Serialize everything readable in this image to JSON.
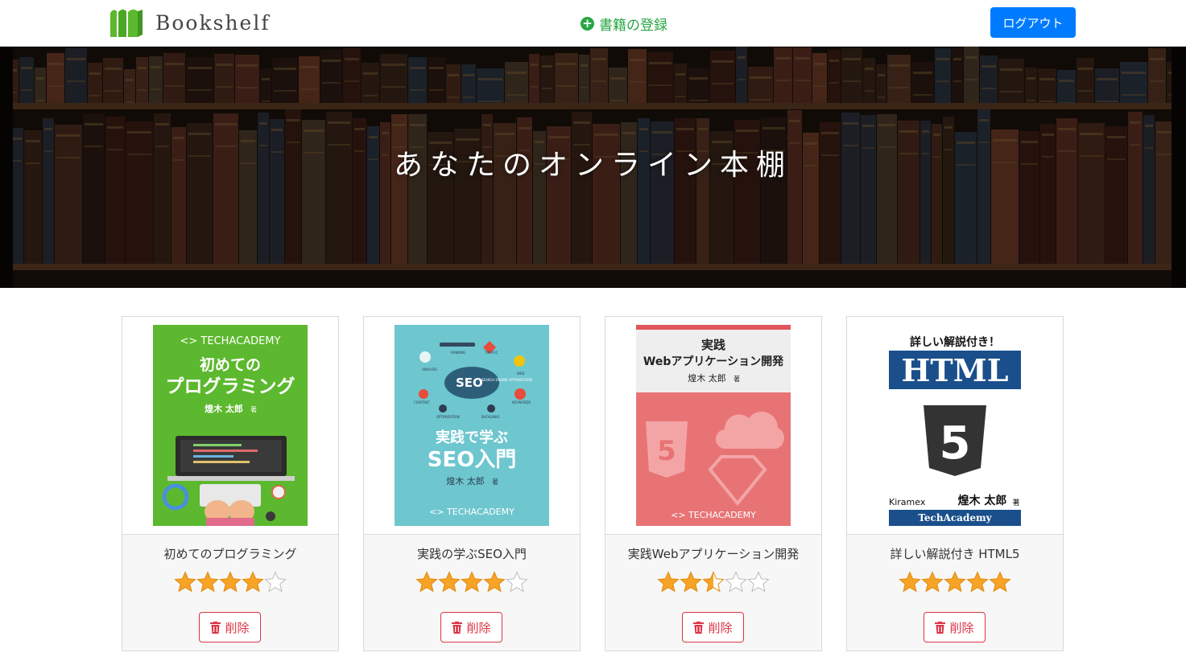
{
  "header": {
    "logo_text": "Bookshelf",
    "register_label": "書籍の登録",
    "logout_label": "ログアウト",
    "colors": {
      "register": "#28a745",
      "logout_bg": "#007bff"
    }
  },
  "hero": {
    "title": "あなたのオンライン本棚"
  },
  "books": [
    {
      "title": "初めてのプログラミング",
      "rating": 4,
      "delete_label": "削除",
      "cover": {
        "brand": "<> TECHACADEMY",
        "title_line1": "初めての",
        "title_line2": "プログラミング",
        "author": "煌木 太郎",
        "author_suffix": "著"
      }
    },
    {
      "title": "実践の学ぶSEO入門",
      "rating": 4,
      "delete_label": "削除",
      "cover": {
        "seo_badge": "SEO",
        "seo_sub": "SEARCH ENGINE OPTIMIZATION",
        "title_line1": "実践で学ぶ",
        "title_line2": "SEO入門",
        "author": "煌木 太郎",
        "author_suffix": "著",
        "brand": "<> TECHACADEMY",
        "icon_labels": [
          "ANALYSIS",
          "RANKING",
          "TRAFFIC",
          "WEB",
          "CONTENT",
          "KEYWORDS",
          "OPTIMIZATION",
          "BACKLINKS"
        ]
      }
    },
    {
      "title": "実践Webアプリケーション開発",
      "rating": 2.5,
      "delete_label": "削除",
      "cover": {
        "title_line1": "実践",
        "title_line2": "Webアプリケーション開発",
        "author": "煌木 太郎",
        "author_suffix": "著",
        "brand": "<> TECHACADEMY"
      }
    },
    {
      "title": "詳しい解説付き HTML5",
      "rating": 5,
      "delete_label": "削除",
      "cover": {
        "top_text": "詳しい解説付き！",
        "banner": "HTML",
        "publisher": "Kiramex",
        "author": "煌木 太郎",
        "author_suffix": "著",
        "footer": "TechAcademy"
      }
    }
  ]
}
